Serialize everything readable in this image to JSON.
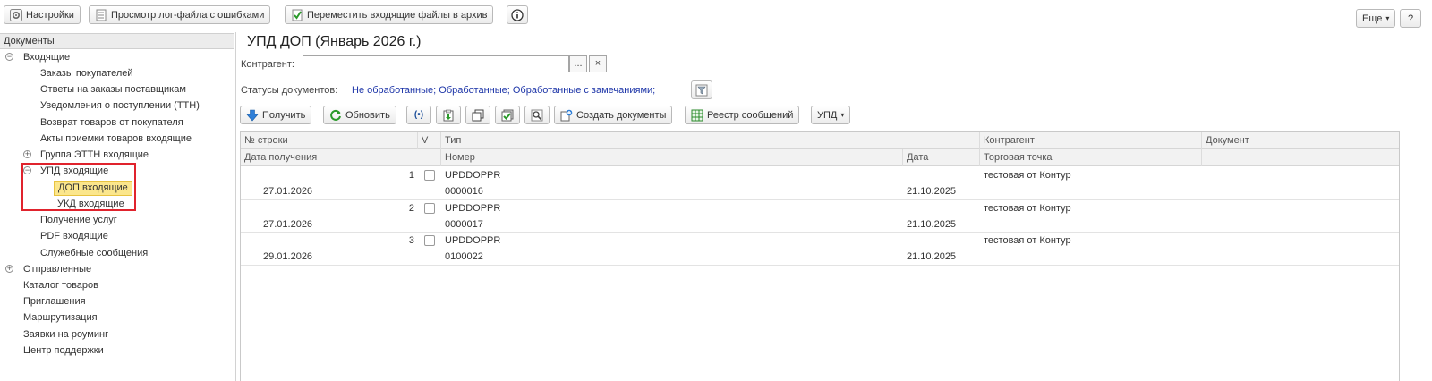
{
  "toolbar": {
    "settings": "Настройки",
    "error_log": "Просмотр лог-файла с ошибками",
    "archive": "Переместить входящие файлы в архив",
    "more": "Еще",
    "help": "?"
  },
  "nav": {
    "header": "Документы",
    "incoming": "Входящие",
    "items": [
      "Заказы покупателей",
      "Ответы на заказы поставщикам",
      "Уведомления о поступлении (ТТН)",
      "Возврат товаров от покупателя",
      "Акты приемки товаров входящие"
    ],
    "group_ettn": "Группа ЭТТН входящие",
    "upd_incoming": "УПД входящие",
    "dop_incoming": "ДОП входящие",
    "ukd_incoming": "УКД входящие",
    "after_items": [
      "Получение услуг",
      "PDF входящие",
      "Служебные сообщения"
    ],
    "sent": "Отправленные",
    "root_items": [
      "Каталог товаров",
      "Приглашения",
      "Маршрутизация",
      "Заявки на роуминг",
      "Центр поддержки"
    ]
  },
  "main": {
    "title": "УПД ДОП (Январь 2026 г.)",
    "counterparty_label": "Контрагент:",
    "counterparty_value": "",
    "select_btn": "...",
    "clear_btn": "×",
    "status_label": "Статусы документов:",
    "status_values": "Не обработанные; Обработанные; Обработанные с замечаниями;"
  },
  "actions": {
    "receive": "Получить",
    "refresh": "Обновить",
    "create_docs": "Создать документы",
    "message_registry": "Реестр сообщений",
    "upd": "УПД"
  },
  "grid": {
    "headers": {
      "row_no": "№ строки",
      "v": "V",
      "type": "Тип",
      "counterparty": "Контрагент",
      "document": "Документ",
      "received": "Дата получения",
      "number": "Номер",
      "date": "Дата",
      "trade_point": "Торговая точка"
    },
    "rows": [
      {
        "row_no": "1",
        "type": "UPDDOPPR",
        "counterparty": "тестовая от Контур",
        "received": "27.01.2026",
        "number": "0000016",
        "date": "21.10.2025"
      },
      {
        "row_no": "2",
        "type": "UPDDOPPR",
        "counterparty": "тестовая от Контур",
        "received": "27.01.2026",
        "number": "0000017",
        "date": "21.10.2025"
      },
      {
        "row_no": "3",
        "type": "UPDDOPPR",
        "counterparty": "тестовая от Контур",
        "received": "29.01.2026",
        "number": "0100022",
        "date": "21.10.2025"
      }
    ]
  }
}
